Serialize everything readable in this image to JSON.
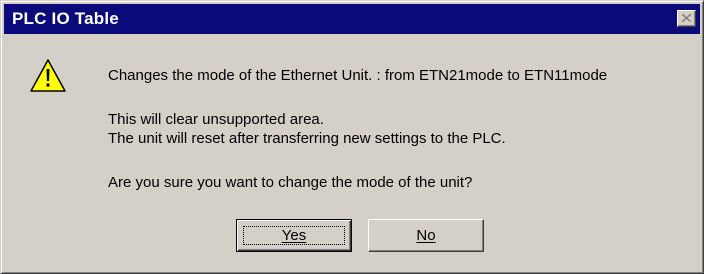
{
  "window": {
    "title": "PLC IO Table",
    "close_icon": "close-icon"
  },
  "icon": {
    "name": "warning-icon",
    "color": "#ffff00"
  },
  "message": {
    "line1": "Changes the mode of the Ethernet Unit. : from ETN21mode to ETN11mode",
    "line2": "This will clear unsupported area.",
    "line3": "The unit will reset after transferring new settings to the PLC.",
    "line4": "Are you sure you want to change the mode of the unit?"
  },
  "buttons": {
    "yes_label": "Yes",
    "no_label": "No"
  },
  "colors": {
    "titlebar": "#0a0a7a",
    "face": "#d4d0c8"
  }
}
